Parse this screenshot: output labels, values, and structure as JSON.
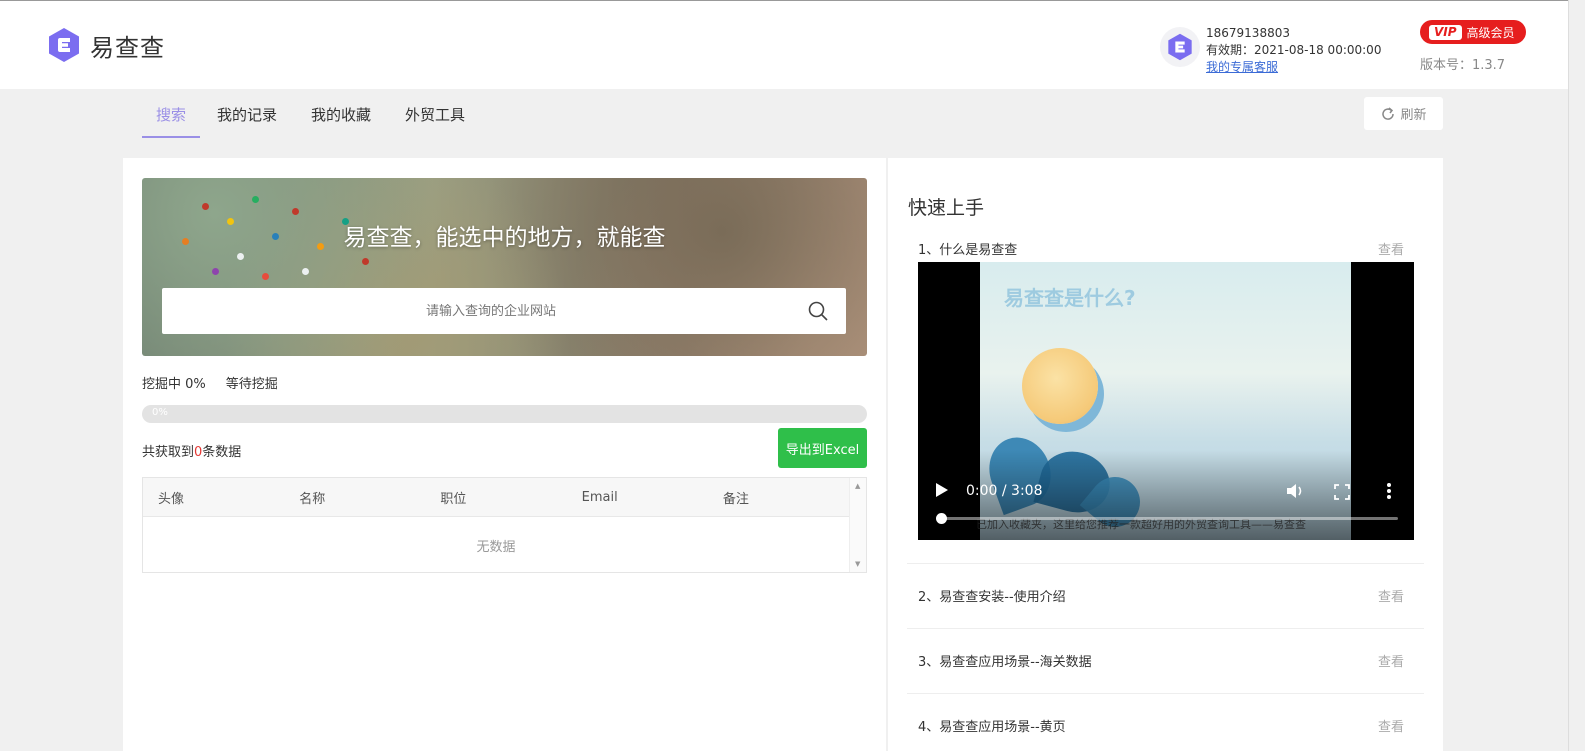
{
  "header": {
    "app_name": "易查查",
    "phone": "18679138803",
    "expiry": "有效期：2021-08-18 00:00:00",
    "service_link": "我的专属客服",
    "vip_tag": "VIP",
    "vip_label": "高级会员",
    "version": "版本号：1.3.7"
  },
  "nav": {
    "tabs": [
      "搜索",
      "我的记录",
      "我的收藏",
      "外贸工具"
    ],
    "active": "搜索",
    "refresh_label": "刷新"
  },
  "search": {
    "banner_title": "易查查，能选中的地方，就能查",
    "placeholder": "请输入查询的企业网站"
  },
  "status": {
    "mining": "挖掘中 0%",
    "waiting": "等待挖掘",
    "progress_percent": 0,
    "progress_label": "0%",
    "count_prefix": "共获取到",
    "count": "0",
    "count_suffix": "条数据",
    "export_label": "导出到Excel"
  },
  "table": {
    "columns": [
      "头像",
      "名称",
      "职位",
      "Email",
      "备注"
    ],
    "rows": [],
    "empty_text": "无数据"
  },
  "quick_start": {
    "title": "快速上手",
    "view_label": "查看",
    "items": [
      "1、什么是易查查",
      "2、易查查安装--使用介绍",
      "3、易查查应用场景--海关数据",
      "4、易查查应用场景--黄页"
    ],
    "video": {
      "overlay_title": "易查查是什么?",
      "time": "0:00 / 3:08",
      "subtitle": "已加入收藏夹，这里给您推荐一款超好用的外贸查询工具——易查查"
    }
  },
  "colors": {
    "accent": "#9a8fe6",
    "vip_red": "#e61e1e",
    "export_green": "#2fbf4a",
    "count_red": "#e53935"
  }
}
